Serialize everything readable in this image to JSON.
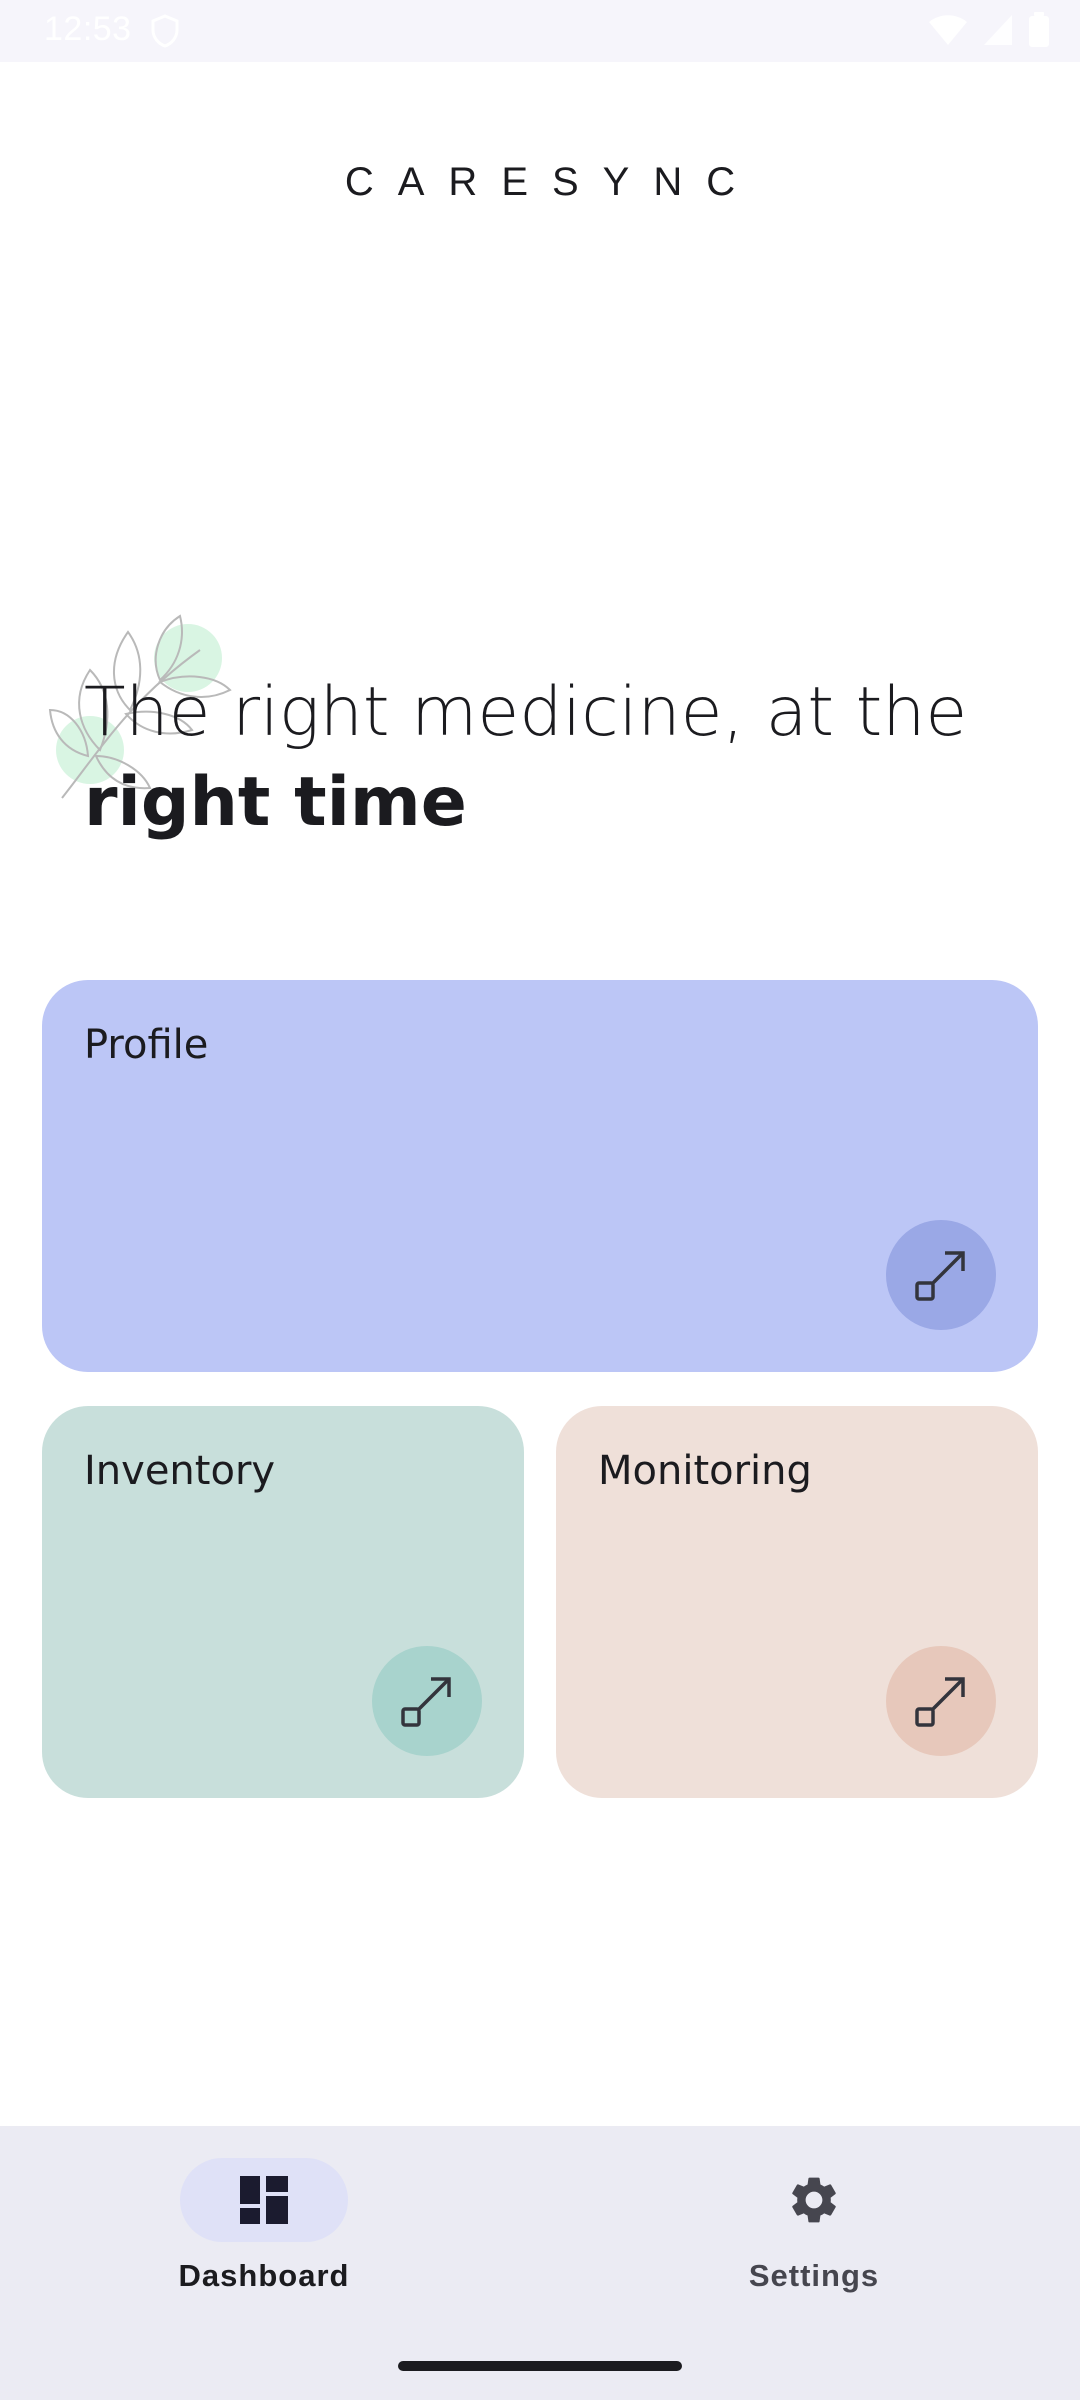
{
  "status_bar": {
    "time": "12:53"
  },
  "brand": {
    "title": "CARESYNC"
  },
  "hero": {
    "line1": "The right medicine, at the",
    "line2": "right time"
  },
  "cards": [
    {
      "label": "Profile",
      "color": "#bcc6f6",
      "action_color": "#9aa8e6",
      "icon": "open-in-full-icon"
    },
    {
      "label": "Inventory",
      "color": "#c8dfdb",
      "action_color": "#a8d3cd",
      "icon": "open-in-full-icon"
    },
    {
      "label": "Monitoring",
      "color": "#efe0d9",
      "action_color": "#e7c8bb",
      "icon": "open-in-full-icon"
    }
  ],
  "bottom_nav": {
    "items": [
      {
        "label": "Dashboard",
        "icon": "dashboard-icon",
        "selected": true
      },
      {
        "label": "Settings",
        "icon": "gear-icon",
        "selected": false
      }
    ],
    "colors": {
      "background": "#ebebf3",
      "selected_pill": "#dfe1f7",
      "selected_text": "#1b1b1f",
      "unselected_text": "#46464f"
    }
  }
}
